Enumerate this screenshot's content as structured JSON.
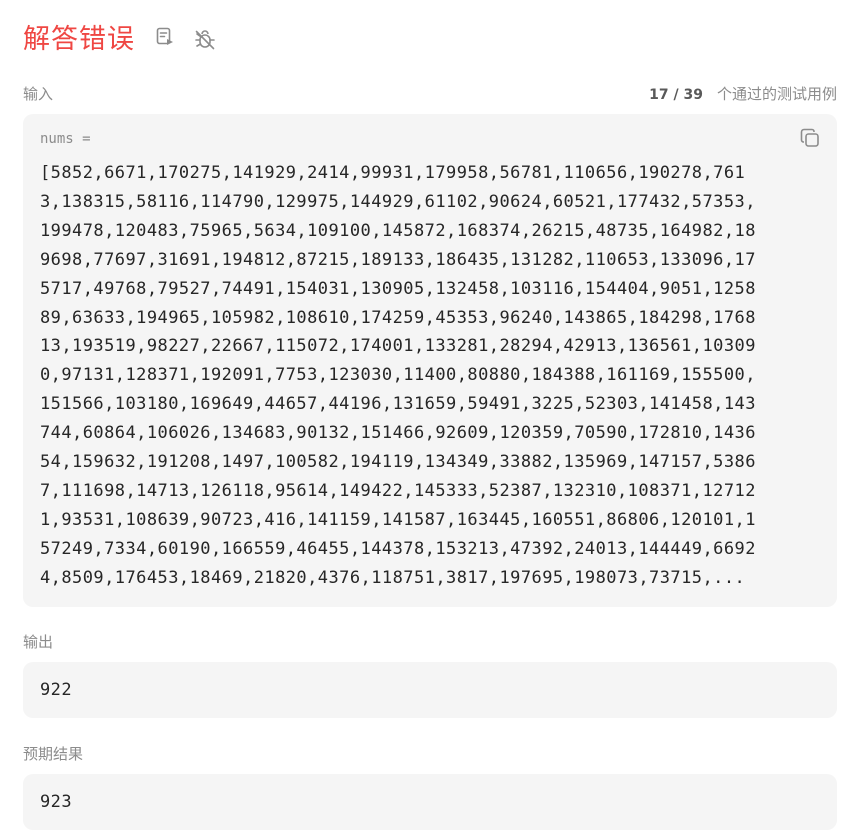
{
  "result": {
    "title": "解答错误"
  },
  "header_icons": [
    "note-icon",
    "debug-icon"
  ],
  "colors": {
    "error_red": "#ef4743",
    "box_background": "#f5f5f5",
    "muted_text": "#8c8c8c"
  },
  "input": {
    "label": "输入",
    "pass_count": "17 / 39",
    "pass_text": "个通过的测试用例",
    "var_name": "nums =",
    "lines": [
      "[5852,6671,170275,141929,2414,99931,179958,56781,110656,190278,761",
      "3,138315,58116,114790,129975,144929,61102,90624,60521,177432,57353,",
      "199478,120483,75965,5634,109100,145872,168374,26215,48735,164982,18",
      "9698,77697,31691,194812,87215,189133,186435,131282,110653,133096,17",
      "5717,49768,79527,74491,154031,130905,132458,103116,154404,9051,1258",
      "89,63633,194965,105982,108610,174259,45353,96240,143865,184298,1768",
      "13,193519,98227,22667,115072,174001,133281,28294,42913,136561,10309",
      "0,97131,128371,192091,7753,123030,11400,80880,184388,161169,155500,",
      "151566,103180,169649,44657,44196,131659,59491,3225,52303,141458,143",
      "744,60864,106026,134683,90132,151466,92609,120359,70590,172810,1436",
      "54,159632,191208,1497,100582,194119,134349,33882,135969,147157,5386",
      "7,111698,14713,126118,95614,149422,145333,52387,132310,108371,12712",
      "1,93531,108639,90723,416,141159,141587,163445,160551,86806,120101,1",
      "57249,7334,60190,166559,46455,144378,153213,47392,24013,144449,6692",
      "4,8509,176453,18469,21820,4376,118751,3817,197695,198073,73715,..."
    ],
    "copy_icon": "copy-icon"
  },
  "output": {
    "label": "输出",
    "value": "922"
  },
  "expected": {
    "label": "预期结果",
    "value": "923"
  }
}
